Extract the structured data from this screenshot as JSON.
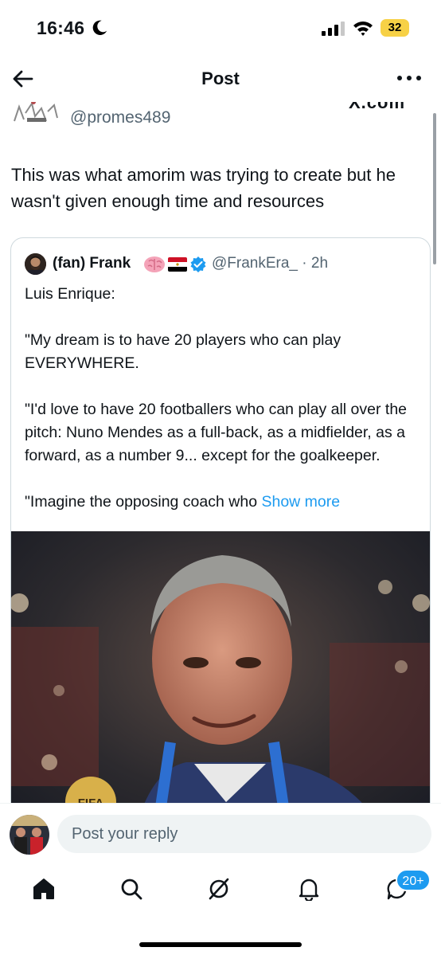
{
  "status_bar": {
    "time": "16:46",
    "battery": "32",
    "icons": [
      "moon-icon",
      "signal-icon",
      "wifi-icon",
      "battery-icon"
    ]
  },
  "header": {
    "title": "Post",
    "icons": [
      "arrow-left-icon",
      "more-dots-icon"
    ]
  },
  "post": {
    "author_handle": "@promes489",
    "watermark": "X.com",
    "text": "This was what amorim was trying to create but he wasn't given enough time and resources"
  },
  "quote": {
    "name": "(fan) Frank",
    "emoji_icons": [
      "brain-icon",
      "egypt-flag-icon",
      "verified-badge-icon"
    ],
    "handle_time": "@FrankEra_ · 2h",
    "paragraphs": [
      "Luis Enrique:",
      "\"My dream is to have 20 players who can play EVERYWHERE.",
      "\"I'd love to have 20 footballers who can play all over the pitch: Nuno Mendes as a full-back, as a midfielder, as a forward, as a number 9... except for the goalkeeper.",
      "\"Imagine the opposing coach who"
    ],
    "show_more": "Show more",
    "photo_text": "FIFA"
  },
  "reply": {
    "placeholder": "Post your reply"
  },
  "tab_bar": {
    "items": [
      "home-icon",
      "search-icon",
      "grok-icon",
      "notifications-icon",
      "messages-icon"
    ],
    "badge": "20+"
  },
  "colors": {
    "accent": "#1d9bf0",
    "text": "#0f1419",
    "muted": "#536471",
    "battery": "#f7d146"
  }
}
